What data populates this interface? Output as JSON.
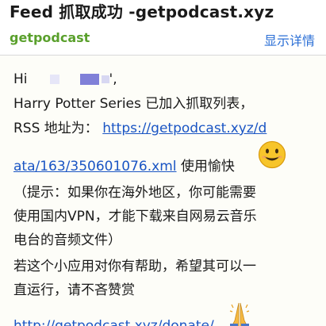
{
  "header": {
    "subject": "Feed 抓取成功 -getpodcast.xyz",
    "sender": "getpodcast",
    "details_link": "显示详情"
  },
  "body": {
    "greeting_prefix": "Hi",
    "greeting_suffix": "',",
    "line_added": "Harry Potter Series 已加入抓取列表，",
    "rss_label": "RSS 地址为：",
    "rss_url_part1": "https://getpodcast.xyz/d",
    "rss_url_part2": "ata/163/350601076.xml",
    "enjoy_text": " 使用愉快",
    "tip_line1": "（提示：如果你在海外地区，你可能需要",
    "tip_line2": "使用国内VPN，才能下载来自网易云音乐",
    "tip_line3": "电台的音频文件）",
    "help_line1": "若这个小应用对你有帮助，希望其可以一",
    "help_line2": "直运行，请不吝赞赏",
    "donate_url": "http://getpodcast.xyz/donate/"
  },
  "icons": {
    "smiley": "smiling-face-emoji-icon",
    "pray": "folded-hands-emoji-icon"
  },
  "colors": {
    "sender": "#5aa02c",
    "details_link": "#2b6fd6",
    "link": "#1a55c4",
    "body_background": "#fdfdf8"
  }
}
